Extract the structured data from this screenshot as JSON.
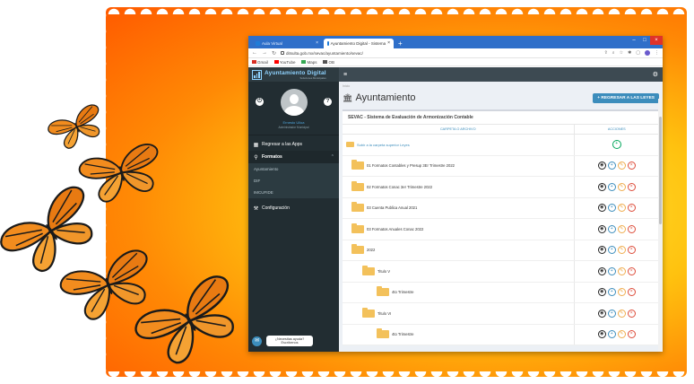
{
  "browser": {
    "tabs": [
      {
        "label": "Aula Virtual",
        "active": false
      },
      {
        "label": "Ayuntamiento Digital - Sistema",
        "active": true
      }
    ],
    "url": "ditsulta.gob.mx/sevac/ayuntamiento/sevac/",
    "bookmarks": [
      "Gmail",
      "YouTube",
      "Maps",
      "OB"
    ]
  },
  "app": {
    "brand": {
      "name": "Ayuntamiento Digital",
      "tagline": "Soluciones Municipales"
    },
    "user": {
      "name": "Ernesto Ulloa",
      "role": "Administrador Municipal"
    },
    "sidebar": {
      "regresar": "Regresar a las Apps",
      "formatos": "Formatos",
      "sub_items": [
        "Ayuntamiento",
        "DIF",
        "IMCUFIDE"
      ],
      "configuracion": "Configuración"
    },
    "help": {
      "question": "¿Necesitas ayuda?",
      "answer": "Escríbenos"
    },
    "breadcrumb": "Inicio",
    "page_title": "Ayuntamiento",
    "back_button": "+ REGRESAR A LAS LEYES",
    "box_title": "SEVAC - Sistema de Evaluación de Armonización Contable",
    "table": {
      "col_folder": "CARPETA O ARCHIVO",
      "col_actions": "ACCIONES",
      "up_label": "Subir a la carpeta superior Leyes",
      "rows": [
        {
          "name": "01 Formatos Contables y Presup 3Er Trimestre 2022",
          "indent": 0
        },
        {
          "name": "02 Formatos Conac 3er Trimestre 2022",
          "indent": 0
        },
        {
          "name": "03 Cuenta Publica Anual 2021",
          "indent": 0
        },
        {
          "name": "03 Formatos Anuales Conac 2022",
          "indent": 0
        },
        {
          "name": "2022",
          "indent": 0
        },
        {
          "name": "Titulo V",
          "indent": 1
        },
        {
          "name": "4to Trimestre",
          "indent": 2
        },
        {
          "name": "Titulo VI",
          "indent": 1
        },
        {
          "name": "4to Trimestre",
          "indent": 2
        }
      ]
    }
  },
  "colors": {
    "frame_center": "#ffe93a",
    "frame_edge": "#ff5a00",
    "sidebar_bg": "#222d32",
    "primary": "#3c8dbc",
    "folder": "#f3c15b"
  }
}
